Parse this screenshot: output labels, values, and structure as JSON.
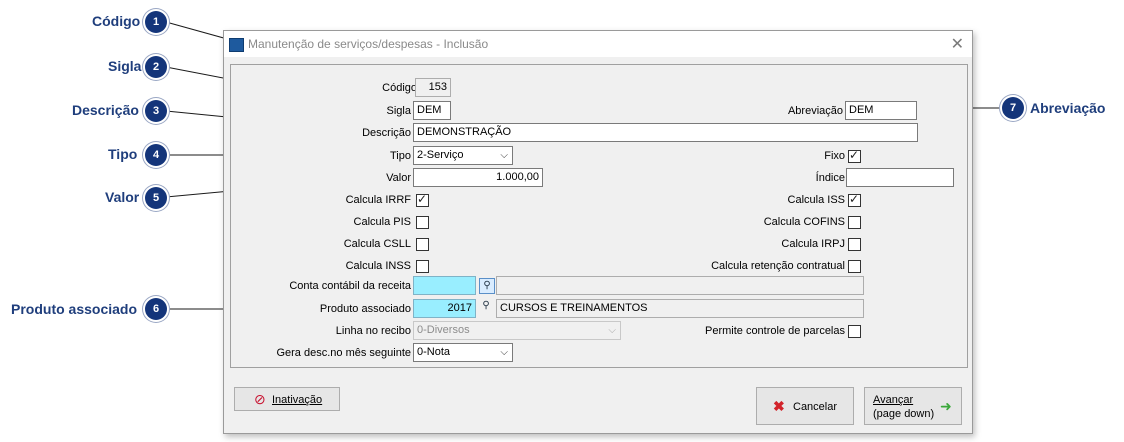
{
  "annotations": [
    {
      "num": "1",
      "label": "Código"
    },
    {
      "num": "2",
      "label": "Sigla"
    },
    {
      "num": "3",
      "label": "Descrição"
    },
    {
      "num": "4",
      "label": "Tipo"
    },
    {
      "num": "5",
      "label": "Valor"
    },
    {
      "num": "6",
      "label": "Produto associado"
    },
    {
      "num": "7",
      "label": "Abreviação"
    }
  ],
  "window": {
    "title": "Manutenção de serviços/despesas - Inclusão",
    "close": "✕"
  },
  "form": {
    "codigo": {
      "label": "Código",
      "value": "153"
    },
    "sigla": {
      "label": "Sigla",
      "value": "DEM"
    },
    "abreviacao": {
      "label": "Abreviação",
      "value": "DEM"
    },
    "descricao": {
      "label": "Descrição",
      "value": "DEMONSTRAÇÃO"
    },
    "tipo": {
      "label": "Tipo",
      "value": "2-Serviço"
    },
    "fixo": {
      "label": "Fixo",
      "checked": true
    },
    "valor": {
      "label": "Valor",
      "value": "1.000,00"
    },
    "indice": {
      "label": "Índice",
      "value": ""
    },
    "calcula_irrf": {
      "label": "Calcula IRRF",
      "checked": true
    },
    "calcula_iss": {
      "label": "Calcula ISS",
      "checked": true
    },
    "calcula_pis": {
      "label": "Calcula PIS",
      "checked": false
    },
    "calcula_cofins": {
      "label": "Calcula COFINS",
      "checked": false
    },
    "calcula_csll": {
      "label": "Calcula CSLL",
      "checked": false
    },
    "calcula_irpj": {
      "label": "Calcula IRPJ",
      "checked": false
    },
    "calcula_inss": {
      "label": "Calcula INSS",
      "checked": false
    },
    "calcula_retencao": {
      "label": "Calcula retenção contratual",
      "checked": false
    },
    "conta_contabil": {
      "label": "Conta contábil da receita",
      "code": "",
      "description": ""
    },
    "produto": {
      "label": "Produto associado",
      "code": "2017",
      "description": "CURSOS E TREINAMENTOS"
    },
    "linha_recibo": {
      "label": "Linha no recibo",
      "value": "0-Diversos"
    },
    "permite_parcelas": {
      "label": "Permite controle de parcelas",
      "checked": false
    },
    "gera_desc": {
      "label": "Gera desc.no mês seguinte",
      "value": "0-Nota"
    }
  },
  "buttons": {
    "inativacao": "Inativação",
    "cancelar": "Cancelar",
    "avancar_line1": "Avançar",
    "avancar_line2": "(page down)"
  },
  "colors": {
    "annotation_badge": "#14357a",
    "annotation_text": "#1f3e7c",
    "lookup_field": "#99eeff"
  }
}
